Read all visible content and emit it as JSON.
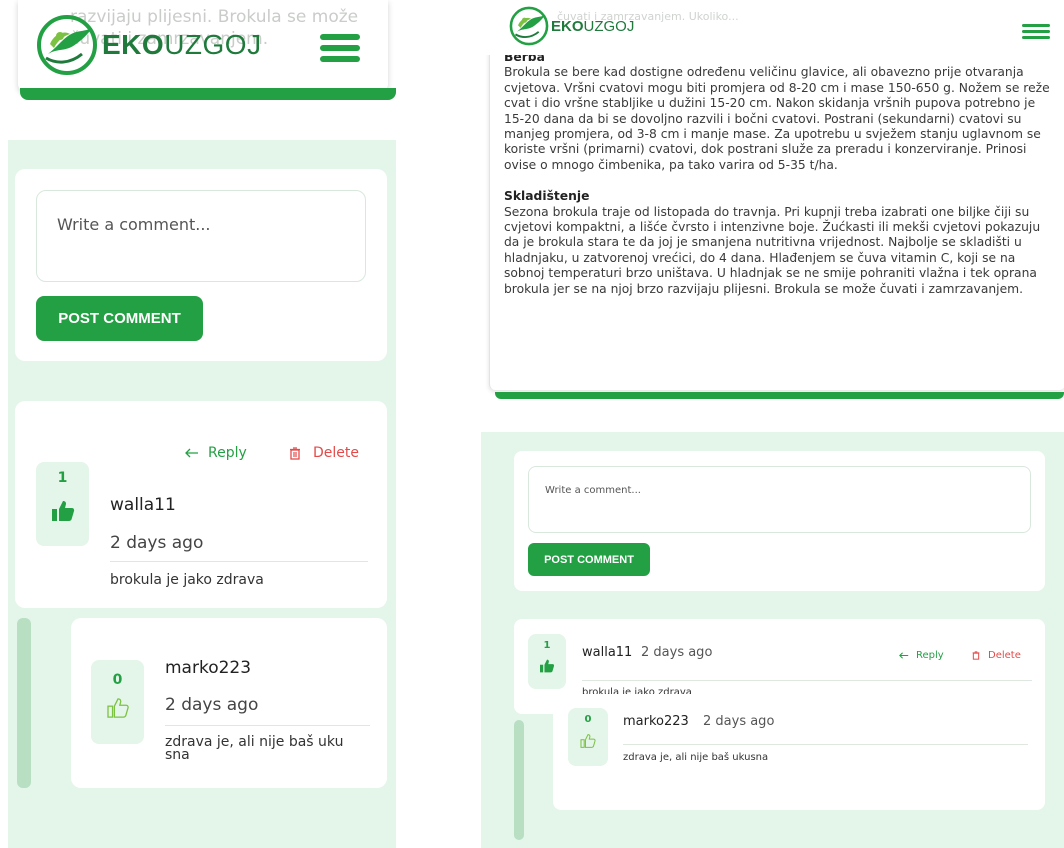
{
  "brand": {
    "prefix": "EKO",
    "suffix": "UZGOJ"
  },
  "mobile": {
    "article_fragment": "razvijaju plijesni. Brokula se može čuvati i zamrzavanjem.",
    "comment_placeholder": "Write a comment...",
    "post_label": "POST COMMENT",
    "reply_label": "Reply",
    "delete_label": "Delete"
  },
  "desktop": {
    "faded_fragment": "čuvati i zamrzavanjem. Ukoliko...",
    "article": {
      "berba_heading": "Berba",
      "berba_text": "Brokula se bere kad dostigne određenu veličinu glavice, ali obavezno prije otvaranja cvjetova. Vršni cvatovi mogu biti promjera od 8-20 cm i mase 150-650 g. Nožem se reže cvat i dio vršne stabljike u dužini 15-20 cm. Nakon skidanja vršnih pupova potrebno je 15-20 dana da bi se dovoljno razvili i bočni cvatovi. Postrani (sekundarni) cvatovi su manjeg promjera, od 3-8 cm i manje mase. Za upotrebu u svježem stanju uglavnom se koriste vršni (primarni) cvatovi, dok postrani služe za preradu i konzerviranje. Prinosi ovise o mnogo čimbenika, pa tako varira od 5-35 t/ha.",
      "skladistenje_heading": "Skladištenje",
      "skladistenje_text": "Sezona brokula traje od listopada do travnja. Pri kupnji treba izabrati one biljke čiji su cvjetovi kompaktni, a lišće čvrsto i intenzivne boje. Žućkasti ili mekši cvjetovi pokazuju da je brokula stara te da joj je smanjena nutritivna vrijednost. Najbolje se skladišti u hladnjaku, u zatvorenoj vrećici, do 4 dana. Hlađenjem se čuva vitamin C, koji se na sobnoj temperaturi brzo uništava. U hladnjak se ne smije pohraniti vlažna i tek oprana brokula jer se na njoj brzo razvijaju plijesni. Brokula se može čuvati i zamrzavanjem."
    },
    "comment_placeholder": "Write a comment...",
    "post_label": "POST COMMENT",
    "reply_label": "Reply",
    "delete_label": "Delete"
  },
  "comments": [
    {
      "votes": "1",
      "author": "walla11",
      "time": "2 days ago",
      "text": "brokula je jako zdrava"
    },
    {
      "votes": "0",
      "author": "marko223",
      "time": "2 days ago",
      "text_mobile_line1": "zdrava je, ali nije baš uku",
      "text_mobile_line2": "sna",
      "text": "zdrava je, ali nije baš ukusna"
    }
  ],
  "colors": {
    "accent": "#23a044",
    "danger": "#e34a4a",
    "comment_bg": "#e4f5e9"
  },
  "icons": {
    "logo": "leaf-hand-logo-icon",
    "menu": "hamburger-menu-icon",
    "reply": "reply-arrow-icon",
    "delete": "trash-icon",
    "like_filled": "thumbs-up-filled-icon",
    "like_outline": "thumbs-up-outline-icon"
  }
}
